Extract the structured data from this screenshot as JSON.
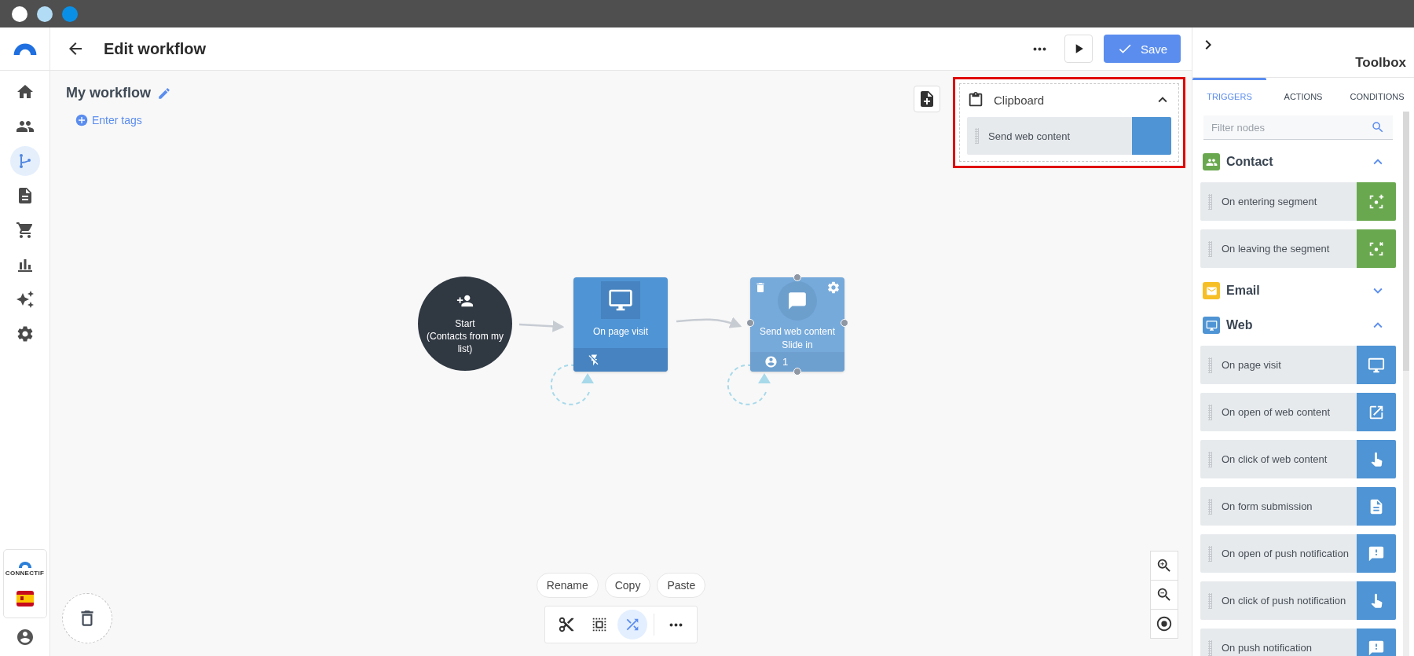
{
  "app": {
    "brand": "CONNECTIF"
  },
  "sidebar": {
    "items": [
      {
        "selected": false
      },
      {
        "selected": false
      },
      {
        "selected": true
      },
      {
        "selected": false
      },
      {
        "selected": false
      },
      {
        "selected": false
      },
      {
        "selected": false
      },
      {
        "selected": false
      }
    ]
  },
  "header": {
    "title": "Edit workflow",
    "save_label": "Save"
  },
  "workflow": {
    "name": "My workflow",
    "tags_link": "Enter tags"
  },
  "canvas": {
    "nodes": [
      {
        "kind": "start",
        "title": "Start",
        "subtitle": "(Contacts from my list)"
      },
      {
        "kind": "trigger",
        "label": "On page visit",
        "selected": false
      },
      {
        "kind": "action",
        "label": "Send web content",
        "sublabel": "Slide in",
        "count": "1",
        "selected": true
      }
    ]
  },
  "clipboard": {
    "title": "Clipboard",
    "expanded": true,
    "items": [
      "Send web content"
    ]
  },
  "context_actions": [
    "Rename",
    "Copy",
    "Paste"
  ],
  "edit_tools": [
    {
      "selected": false
    },
    {
      "selected": false
    },
    {
      "selected": true
    }
  ],
  "toolbox": {
    "title": "Toolbox",
    "tabs": [
      {
        "label": "TRIGGERS",
        "selected": true
      },
      {
        "label": "ACTIONS",
        "selected": false
      },
      {
        "label": "CONDITIONS",
        "selected": false
      }
    ],
    "filter": {
      "placeholder": "Filter nodes"
    },
    "groups": [
      {
        "name": "Contact",
        "color": "#6aa84f",
        "expanded": true,
        "items": [
          "On entering segment",
          "On leaving the segment"
        ]
      },
      {
        "name": "Email",
        "color": "#f6bf26",
        "expanded": false
      },
      {
        "name": "Web",
        "color": "#4f94d4",
        "expanded": true,
        "items": [
          "On page visit",
          "On open of web content",
          "On click of web content",
          "On form submission",
          "On open of push notification",
          "On click of push notification",
          "On push notification"
        ]
      }
    ]
  }
}
